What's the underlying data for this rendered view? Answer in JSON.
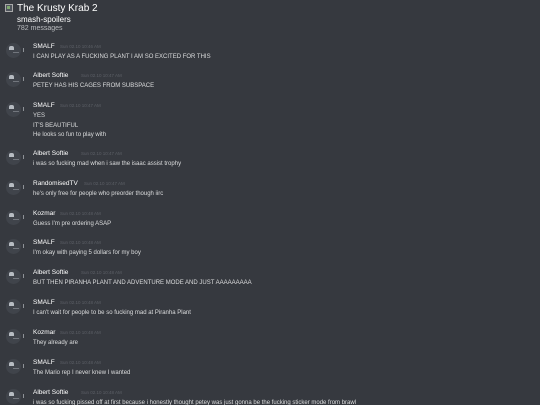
{
  "header": {
    "server_name": "The Krusty Krab 2",
    "channel_name": "smash-spoilers",
    "message_count": "782 messages"
  },
  "messages": [
    {
      "author": "SMALF",
      "timestamp": "Sun 02.10 10:46 AM",
      "lines": [
        "I CAN PLAY AS A FUCKING PLANT I AM SO EXCITED FOR THIS"
      ]
    },
    {
      "author": "Albert Softie",
      "timestamp": "Sun 02.10 10:47 AM",
      "lines": [
        "PETEY HAS HIS CAGES FROM SUBSPACE"
      ]
    },
    {
      "author": "SMALF",
      "timestamp": "Sun 02.10 10:47 AM",
      "lines": [
        "YES",
        "IT'S BEAUTIFUL",
        "He looks so fun to play with"
      ]
    },
    {
      "author": "Albert Softie",
      "timestamp": "Sun 02.10 10:47 AM",
      "lines": [
        "i was so fucking mad when i saw the isaac assist trophy"
      ]
    },
    {
      "author": "RandomisedTV",
      "timestamp": "Sun 02.10 10:47 AM",
      "lines": [
        "he's only free for people who preorder though iirc"
      ]
    },
    {
      "author": "Kozmar",
      "timestamp": "Sun 02.10 10:48 AM",
      "lines": [
        "Guess I'm pre ordering ASAP"
      ]
    },
    {
      "author": "SMALF",
      "timestamp": "Sun 02.10 10:48 AM",
      "lines": [
        "I'm okay with paying 5 dollars for my boy"
      ]
    },
    {
      "author": "Albert Softie",
      "timestamp": "Sun 02.10 10:48 AM",
      "lines": [
        "BUT THEN PIRANHA PLANT AND ADVENTURE MODE AND JUST AAAAAAAAA"
      ]
    },
    {
      "author": "SMALF",
      "timestamp": "Sun 02.10 10:48 AM",
      "lines": [
        "I can't wait for people to be so fucking mad at Piranha Plant"
      ]
    },
    {
      "author": "Kozmar",
      "timestamp": "Sun 02.10 10:48 AM",
      "lines": [
        "They already are"
      ]
    },
    {
      "author": "SMALF",
      "timestamp": "Sun 02.10 10:48 AM",
      "lines": [
        "The Mario rep I never knew I wanted"
      ]
    },
    {
      "author": "Albert Softie",
      "timestamp": "Sun 02.10 10:48 AM",
      "lines": [
        "i was so fucking pissed off at first because i honestly thought petey was just gonna be the fucking sticker mode from brawl"
      ]
    }
  ]
}
